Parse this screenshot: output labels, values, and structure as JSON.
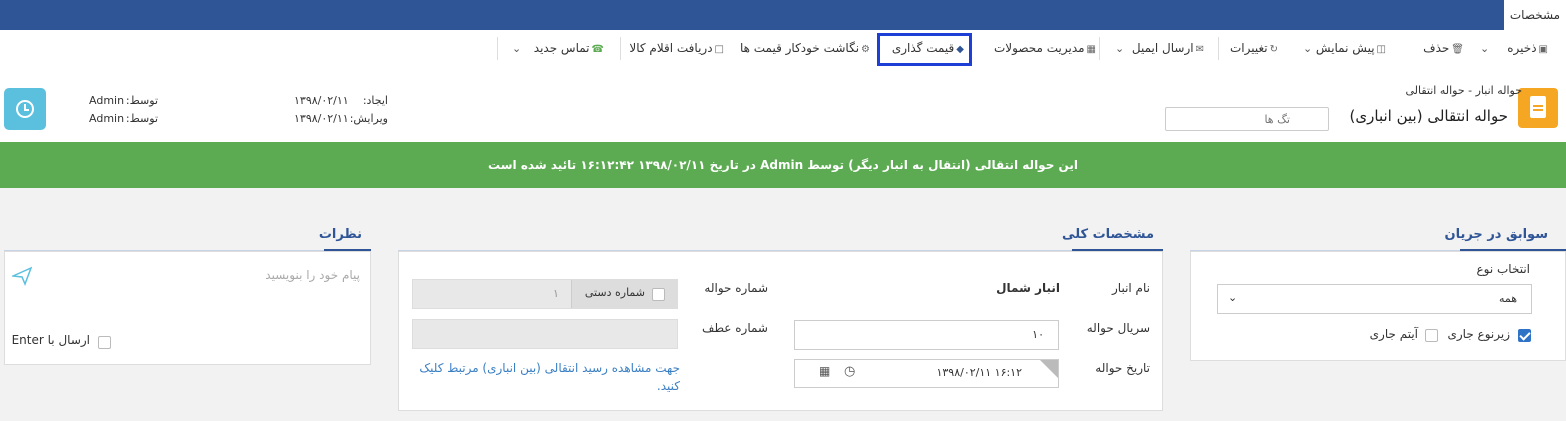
{
  "window": {
    "tab_label": "مشخصات"
  },
  "toolbar": {
    "save": "ذخیره",
    "delete": "حذف",
    "preview": "پیش نمایش",
    "changes": "تغییرات",
    "send_email": "ارسال ایمیل",
    "manage_products": "مدیریت محصولات",
    "pricing": "قیمت گذاری",
    "auto_price_mapping": "نگاشت خودکار قیمت ها",
    "receive_items": "دریافت اقلام کالا",
    "new_contact": "تماس جدید"
  },
  "header": {
    "breadcrumb": "حواله انبار -  حواله انتقالی",
    "title": "حواله انتقالی (بین انباری)",
    "tags_placeholder": "تگ ها",
    "created_label": "ایجاد:",
    "created_date": "۱۳۹۸/۰۲/۱۱",
    "created_by_label": "توسط:",
    "created_by": "Admin",
    "edited_label": "ویرایش:",
    "edited_date": "۱۳۹۸/۰۲/۱۱",
    "edited_by_label": "توسط:",
    "edited_by": "Admin"
  },
  "banner": {
    "text": "این حواله انتقالی (انتقال به انبار دیگر) توسط Admin در تاریخ ۱۳۹۸/۰۲/۱۱ ۱۶:۱۲:۴۲ تائید شده است"
  },
  "workflow": {
    "title": "سوابق در جریان",
    "type_label": "انتخاب نوع",
    "type_value": "همه",
    "current_subtype": "زیرنوع جاری",
    "current_item": "آیتم جاری"
  },
  "general": {
    "title": "مشخصات کلی",
    "warehouse_label": "نام انبار",
    "warehouse_value": "انبار شمال",
    "serial_label": "سریال حواله",
    "serial_value": "۱۰",
    "date_label": "تاریخ حواله",
    "date_value": "۱۳۹۸/۰۲/۱۱ ۱۶:۱۲",
    "number_label": "شماره حواله",
    "manual_number_label": "شماره دستی",
    "number_value": "۱",
    "ref_label": "شماره عطف",
    "receipt_link": "جهت مشاهده رسید انتقالی (بین انباری) مرتبط کلیک کنید."
  },
  "comments": {
    "title": "نظرات",
    "placeholder": "پیام خود را بنویسید",
    "send_with_enter": "ارسال با Enter"
  },
  "colors": {
    "nav": "#2f5597",
    "banner": "#5cab52",
    "accent": "#f5a623",
    "info": "#5bc0de",
    "highlight": "#1d3fd6"
  }
}
